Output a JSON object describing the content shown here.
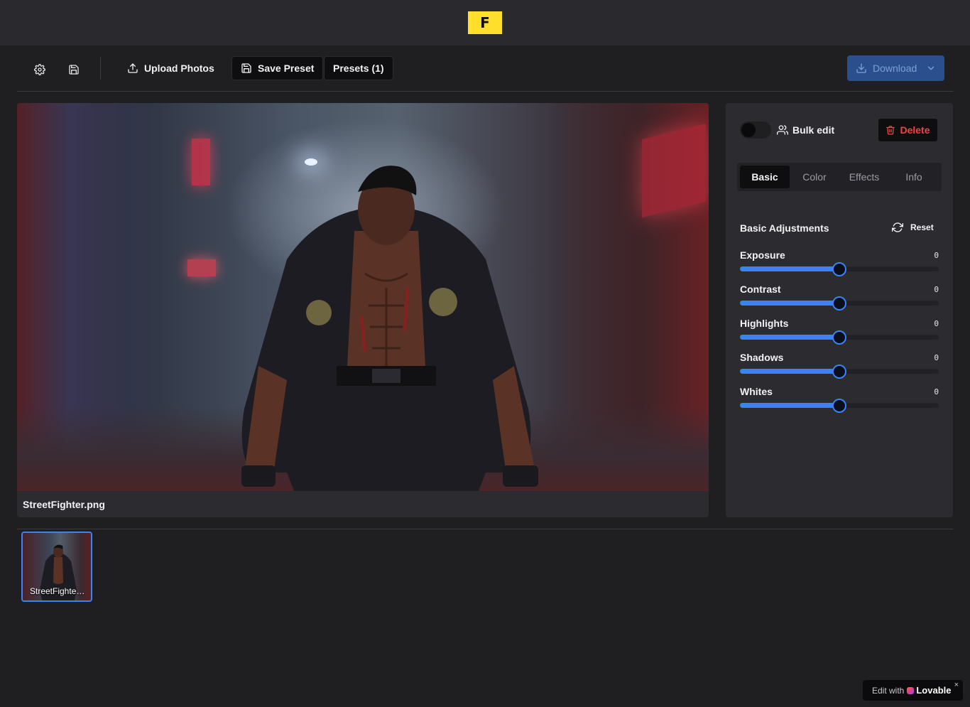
{
  "header": {
    "logo_letter": "F"
  },
  "toolbar": {
    "settings_icon": "gear-icon",
    "save_icon": "floppy-icon",
    "upload_label": "Upload Photos",
    "save_preset_label": "Save Preset",
    "presets_label": "Presets (1)",
    "download_label": "Download"
  },
  "preview": {
    "filename": "StreetFighter.png"
  },
  "panel": {
    "bulk_edit_label": "Bulk edit",
    "bulk_edit_enabled": false,
    "delete_label": "Delete",
    "tabs": [
      {
        "label": "Basic",
        "active": true
      },
      {
        "label": "Color",
        "active": false
      },
      {
        "label": "Effects",
        "active": false
      },
      {
        "label": "Info",
        "active": false
      }
    ],
    "section_title": "Basic Adjustments",
    "reset_label": "Reset",
    "sliders": [
      {
        "label": "Exposure",
        "value": "0",
        "level": 0.5
      },
      {
        "label": "Contrast",
        "value": "0",
        "level": 0.5
      },
      {
        "label": "Highlights",
        "value": "0",
        "level": 0.5
      },
      {
        "label": "Shadows",
        "value": "0",
        "level": 0.5
      },
      {
        "label": "Whites",
        "value": "0",
        "level": 0.5
      }
    ]
  },
  "filmstrip": {
    "items": [
      {
        "name": "StreetFighter.png",
        "selected": true
      }
    ]
  },
  "badge": {
    "prefix": "Edit with",
    "brand": "Lovable",
    "close": "×"
  },
  "colors": {
    "accent": "#3b82f6",
    "danger": "#ef4444",
    "logo": "#ffdf2b",
    "download_bg": "#2b4f8c"
  }
}
